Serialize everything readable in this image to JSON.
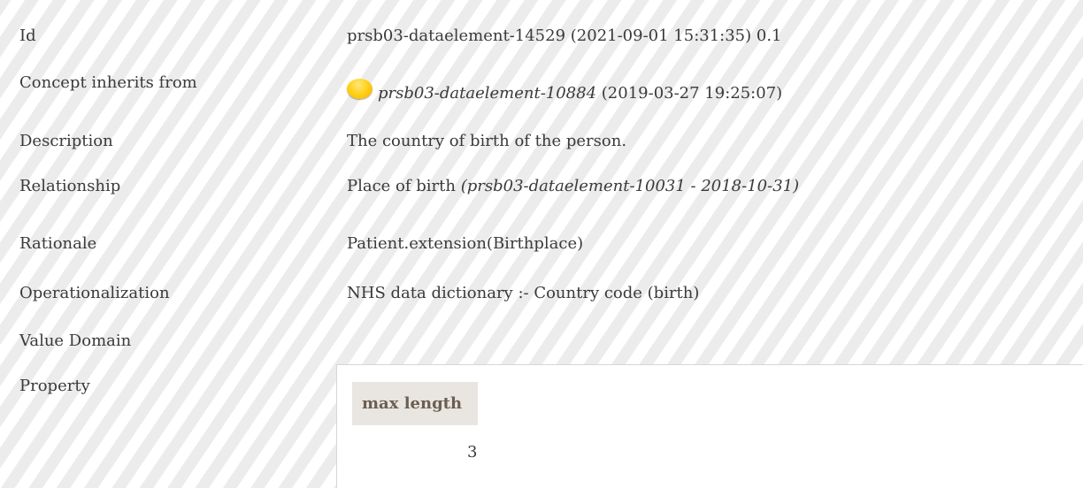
{
  "rows": {
    "id": {
      "label": "Id",
      "value": "prsb03-dataelement-14529 (2021-09-01 15:31:35) 0.1"
    },
    "inherits": {
      "label": "Concept inherits from",
      "ref": "prsb03-dataelement-10884",
      "date": "(2019-03-27 19:25:07)",
      "status_color": "#ffd21a"
    },
    "description": {
      "label": "Description",
      "value": "The country of birth of the person."
    },
    "relationship": {
      "label": "Relationship",
      "value": "Place of birth",
      "ref": "(prsb03-dataelement-10031 - 2018-10-31)"
    },
    "rationale": {
      "label": "Rationale",
      "value": "Patient.extension(Birthplace)"
    },
    "operationalization": {
      "label": "Operationalization",
      "value": "NHS data dictionary :- Country code (birth)"
    },
    "value_domain": {
      "label": "Value Domain"
    },
    "property": {
      "label": "Property",
      "column_header": "max length",
      "column_value": "3"
    }
  }
}
